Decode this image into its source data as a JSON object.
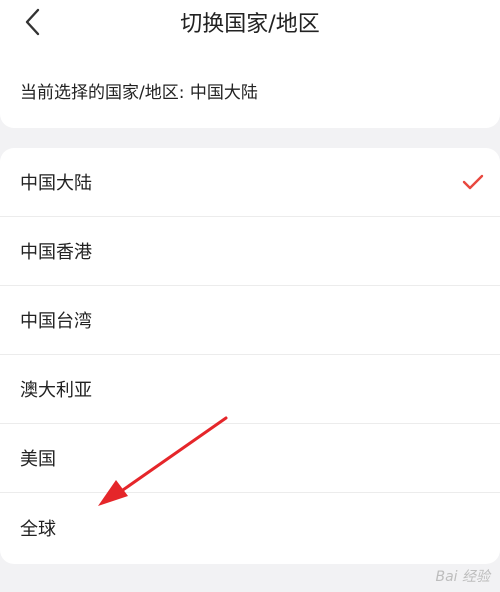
{
  "header": {
    "title": "切换国家/地区",
    "current_text": "当前选择的国家/地区: 中国大陆"
  },
  "regions": [
    {
      "label": "中国大陆",
      "selected": true
    },
    {
      "label": "中国香港",
      "selected": false
    },
    {
      "label": "中国台湾",
      "selected": false
    },
    {
      "label": "澳大利亚",
      "selected": false
    },
    {
      "label": "美国",
      "selected": false
    },
    {
      "label": "全球",
      "selected": false
    }
  ],
  "colors": {
    "accent": "#e8473e",
    "annotation_arrow": "#e5262a"
  },
  "watermark": "Bai 经验"
}
